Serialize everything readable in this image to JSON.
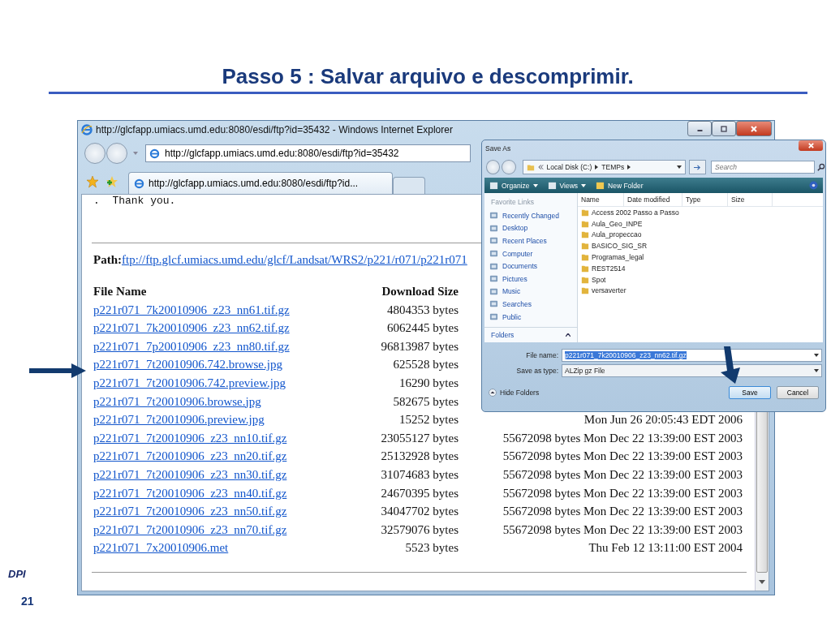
{
  "slide": {
    "title": "Passo 5 : Salvar arquivo e descomprimir.",
    "logo": "DPI",
    "page_number": "21"
  },
  "browser": {
    "title": "http://glcfapp.umiacs.umd.edu:8080/esdi/ftp?id=35432 - Windows Internet Explorer",
    "address": "http://glcfapp.umiacs.umd.edu:8080/esdi/ftp?id=35432",
    "tab": "http://glcfapp.umiacs.umd.edu:8080/esdi/ftp?id...",
    "top_text": ".  Thank you.",
    "path_label": "Path:",
    "path_link": "ftp://ftp.glcf.umiacs.umd.edu/glcf/Landsat/WRS2/p221/r071/p221r071",
    "columns": [
      "File Name",
      "Download Size"
    ],
    "files": [
      {
        "name": "p221r071_7k20010906_z23_nn61.tif.gz",
        "size": "4804353 bytes"
      },
      {
        "name": "p221r071_7k20010906_z23_nn62.tif.gz",
        "size": "6062445 bytes"
      },
      {
        "name": "p221r071_7p20010906_z23_nn80.tif.gz",
        "size": "96813987 bytes"
      },
      {
        "name": "p221r071_7t20010906.742.browse.jpg",
        "size": "625528 bytes"
      },
      {
        "name": "p221r071_7t20010906.742.preview.jpg",
        "size": "16290 bytes"
      },
      {
        "name": "p221r071_7t20010906.browse.jpg",
        "size": "582675 bytes"
      },
      {
        "name": "p221r071_7t20010906.preview.jpg",
        "size": "15252 bytes",
        "date": "Mon Jun 26 20:05:43 EDT 2006"
      },
      {
        "name": "p221r071_7t20010906_z23_nn10.tif.gz",
        "size": "23055127 bytes",
        "date": "55672098 bytes Mon Dec 22 13:39:00 EST 2003"
      },
      {
        "name": "p221r071_7t20010906_z23_nn20.tif.gz",
        "size": "25132928 bytes",
        "date": "55672098 bytes Mon Dec 22 13:39:00 EST 2003"
      },
      {
        "name": "p221r071_7t20010906_z23_nn30.tif.gz",
        "size": "31074683 bytes",
        "date": "55672098 bytes Mon Dec 22 13:39:00 EST 2003"
      },
      {
        "name": "p221r071_7t20010906_z23_nn40.tif.gz",
        "size": "24670395 bytes",
        "date": "55672098 bytes Mon Dec 22 13:39:00 EST 2003"
      },
      {
        "name": "p221r071_7t20010906_z23_nn50.tif.gz",
        "size": "34047702 bytes",
        "date": "55672098 bytes Mon Dec 22 13:39:00 EST 2003"
      },
      {
        "name": "p221r071_7t20010906_z23_nn70.tif.gz",
        "size": "32579076 bytes",
        "date": "55672098 bytes Mon Dec 22 13:39:00 EST 2003"
      },
      {
        "name": "p221r071_7x20010906.met",
        "size": "5523 bytes",
        "date": "Thu Feb 12 13:11:00 EST 2004"
      }
    ]
  },
  "dialog": {
    "title": "Save As",
    "breadcrumb": [
      "Local Disk (C:)",
      "TEMPs"
    ],
    "search": {
      "placeholder": "Search"
    },
    "toolbar": [
      "Organize",
      "Views",
      "New Folder"
    ],
    "favorites_heading": "Favorite Links",
    "links": [
      "Recently Changed",
      "Desktop",
      "Recent Places",
      "Computer",
      "Documents",
      "Pictures",
      "Music",
      "Searches",
      "Public"
    ],
    "folders_heading": "Folders",
    "columns": [
      "Name",
      "Date modified",
      "Type",
      "Size"
    ],
    "folders": [
      "Access 2002 Passo a Passo",
      "Aula_Geo_INPE",
      "Aula_propeccao",
      "BASICO_SIG_SR",
      "Programas_legal",
      "REST2514",
      "Spot",
      "versaverter"
    ],
    "file_name_label": "File name:",
    "file_name": "p221r071_7k20010906_z23_nn62.tif.gz",
    "file_name_selected": true,
    "type_label": "Save as type:",
    "type": "ALZip gz File",
    "hide_folders": "Hide Folders",
    "buttons": [
      {
        "label": "Save",
        "default": true
      },
      {
        "label": "Cancel",
        "default": false
      }
    ]
  }
}
